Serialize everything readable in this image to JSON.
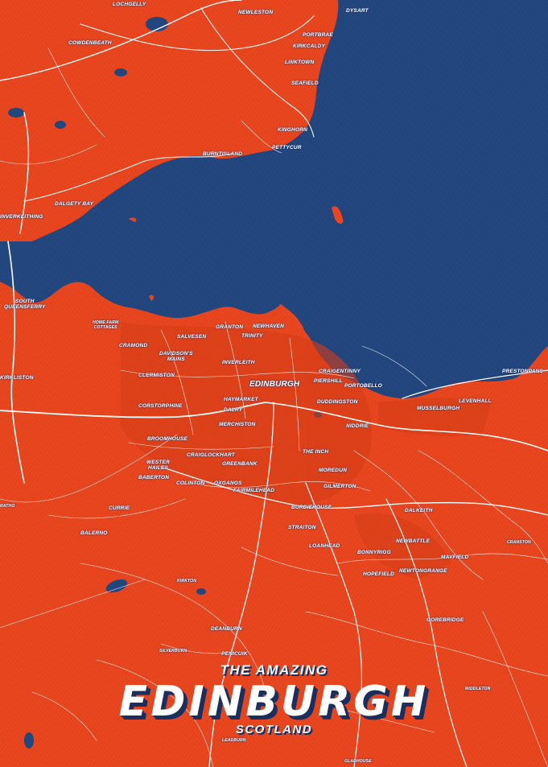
{
  "poster": {
    "pre_title": "THE AMAZING",
    "title": "EDINBURGH",
    "subtitle": "SCOTLAND"
  },
  "colors": {
    "land": "#e8461e",
    "water": "#22467e",
    "roads": "#ffffff",
    "label_shadow": "#1b2f5e"
  },
  "places": [
    {
      "id": "lochgelly",
      "name": "LOCHGELLY"
    },
    {
      "id": "newleston",
      "name": "NEWLESTON"
    },
    {
      "id": "dysart",
      "name": "DYSART"
    },
    {
      "id": "cowdenbeath",
      "name": "COWDENBEATH"
    },
    {
      "id": "portbrae",
      "name": "PORTBRAE"
    },
    {
      "id": "kirkcaldy",
      "name": "KIRKCALDY"
    },
    {
      "id": "linktown",
      "name": "LINKTOWN"
    },
    {
      "id": "seafield",
      "name": "SEAFIELD"
    },
    {
      "id": "kinghorn",
      "name": "KINGHORN"
    },
    {
      "id": "pettycur",
      "name": "PETTYCUR"
    },
    {
      "id": "burntisland",
      "name": "BURNTISLAND"
    },
    {
      "id": "dalgety_bay",
      "name": "DALGETY BAY"
    },
    {
      "id": "inverkeithing",
      "name": "INVERKEITHING"
    },
    {
      "id": "south_queensferry",
      "name": "SOUTH\nQUEENSFERRY"
    },
    {
      "id": "home_farm",
      "name": "HOME FARM\nCOTTAGES"
    },
    {
      "id": "granton",
      "name": "GRANTON"
    },
    {
      "id": "newhaven",
      "name": "NEWHAVEN"
    },
    {
      "id": "salvesen",
      "name": "SALVESEN"
    },
    {
      "id": "trinity",
      "name": "TRINITY"
    },
    {
      "id": "cramond",
      "name": "CRAMOND"
    },
    {
      "id": "davidsons_mains",
      "name": "DAVIDSON'S\nMAINS"
    },
    {
      "id": "inverleith",
      "name": "INVERLEITH"
    },
    {
      "id": "craigentinny",
      "name": "CRAIGENTINNY"
    },
    {
      "id": "prestonpans",
      "name": "PRESTONPANS"
    },
    {
      "id": "kirkliston",
      "name": "KIRKLISTON"
    },
    {
      "id": "clermiston",
      "name": "CLERMISTON"
    },
    {
      "id": "edinburgh",
      "name": "EDINBURGH"
    },
    {
      "id": "piershill",
      "name": "PIERSHILL"
    },
    {
      "id": "portobello",
      "name": "PORTOBELLO"
    },
    {
      "id": "haymarket",
      "name": "HAYMARKET"
    },
    {
      "id": "duddingston",
      "name": "DUDDINGSTON"
    },
    {
      "id": "levenhall",
      "name": "LEVENHALL"
    },
    {
      "id": "corstorphine",
      "name": "CORSTORPHINE"
    },
    {
      "id": "dalry",
      "name": "DALRY"
    },
    {
      "id": "musselburgh",
      "name": "MUSSELBURGH"
    },
    {
      "id": "merchiston",
      "name": "MERCHISTON"
    },
    {
      "id": "niddrie",
      "name": "NIDDRIE"
    },
    {
      "id": "broomhouse",
      "name": "BROOMHOUSE"
    },
    {
      "id": "the_inch",
      "name": "THE INCH"
    },
    {
      "id": "craiglockhart",
      "name": "CRAIGLOCKHART"
    },
    {
      "id": "greenbank",
      "name": "GREENBANK"
    },
    {
      "id": "wester_hailes",
      "name": "WESTER\nHAILES"
    },
    {
      "id": "moredun",
      "name": "MOREDUN"
    },
    {
      "id": "baberton",
      "name": "BABERTON"
    },
    {
      "id": "colinton",
      "name": "COLINTON"
    },
    {
      "id": "oxgangs",
      "name": "OXGANGS"
    },
    {
      "id": "gilmerton",
      "name": "GILMERTON"
    },
    {
      "id": "fairmilehead",
      "name": "FAIRMILEHEAD"
    },
    {
      "id": "ratho",
      "name": "RATHO"
    },
    {
      "id": "currie",
      "name": "CURRIE"
    },
    {
      "id": "burdiehouse",
      "name": "BURDIEHOUSE"
    },
    {
      "id": "dalkeith",
      "name": "DALKEITH"
    },
    {
      "id": "straiton",
      "name": "STRAITON"
    },
    {
      "id": "balerno",
      "name": "BALERNO"
    },
    {
      "id": "newbattle",
      "name": "NEWBATTLE"
    },
    {
      "id": "cranston",
      "name": "CRANSTON"
    },
    {
      "id": "loanhead",
      "name": "LOANHEAD"
    },
    {
      "id": "bonnyrigg",
      "name": "BONNYRIGG"
    },
    {
      "id": "mayfield",
      "name": "MAYFIELD"
    },
    {
      "id": "newtongrange",
      "name": "NEWTONGRANGE"
    },
    {
      "id": "hopefield",
      "name": "HOPEFIELD"
    },
    {
      "id": "kirkton",
      "name": "KIRKTON"
    },
    {
      "id": "gorebridge",
      "name": "GOREBRIDGE"
    },
    {
      "id": "deanburn",
      "name": "DEANBURN"
    },
    {
      "id": "silverburn",
      "name": "SILVERBURN"
    },
    {
      "id": "penicuik",
      "name": "PENICUIK"
    },
    {
      "id": "middleton",
      "name": "MIDDLETON"
    },
    {
      "id": "leadburn",
      "name": "LEADBURN"
    },
    {
      "id": "gladhouse",
      "name": "GLADHOUSE"
    }
  ]
}
